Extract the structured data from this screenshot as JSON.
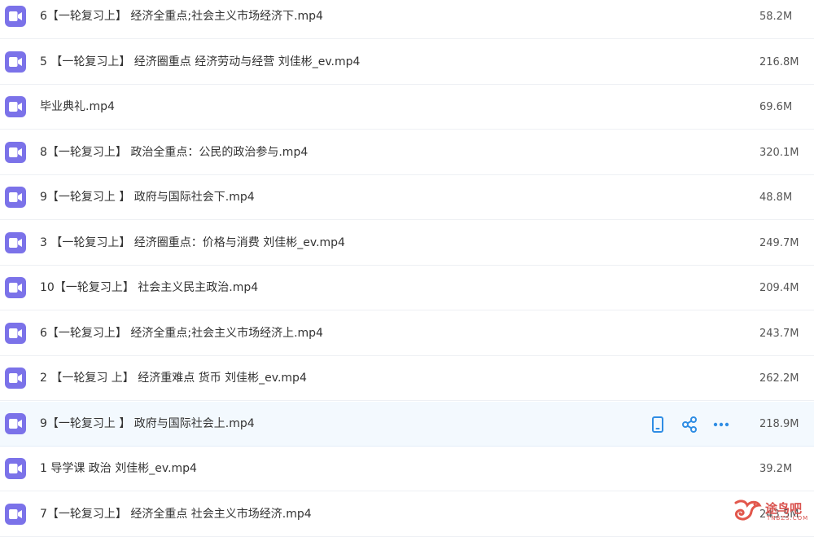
{
  "files": [
    {
      "name": "6【一轮复习上】 经济全重点;社会主义市场经济下.mp4",
      "size": "58.2M"
    },
    {
      "name": "5 【一轮复习上】 经济圈重点 经济劳动与经营 刘佳彬_ev.mp4",
      "size": "216.8M"
    },
    {
      "name": "毕业典礼.mp4",
      "size": "69.6M"
    },
    {
      "name": "8【一轮复习上】 政治全重点：公民的政治参与.mp4",
      "size": "320.1M"
    },
    {
      "name": "9【一轮复习上 】 政府与国际社会下.mp4",
      "size": "48.8M"
    },
    {
      "name": "3 【一轮复习上】 经济圈重点：价格与消费 刘佳彬_ev.mp4",
      "size": "249.7M"
    },
    {
      "name": "10【一轮复习上】 社会主义民主政治.mp4",
      "size": "209.4M"
    },
    {
      "name": "6【一轮复习上】 经济全重点;社会主义市场经济上.mp4",
      "size": "243.7M"
    },
    {
      "name": "2 【一轮复习 上】 经济重难点 货币 刘佳彬_ev.mp4",
      "size": "262.2M"
    },
    {
      "name": "9【一轮复习上 】 政府与国际社会上.mp4",
      "size": "218.9M"
    },
    {
      "name": "1 导学课 政治 刘佳彬_ev.mp4",
      "size": "39.2M"
    },
    {
      "name": "7【一轮复习上】 经济全重点 社会主义市场经济.mp4",
      "size": "243.5M"
    }
  ],
  "highlighted_row": 9,
  "row_actions": [
    {
      "icon": "phone-icon"
    },
    {
      "icon": "share-icon"
    },
    {
      "icon": "more-icon"
    }
  ],
  "watermark": {
    "text": "途鸟吧",
    "sub": "TNBZS.COM"
  },
  "colors": {
    "icon_bg": "#7b72e9",
    "action": "#2f8de4",
    "highlight_bg": "#f3f9fe"
  }
}
